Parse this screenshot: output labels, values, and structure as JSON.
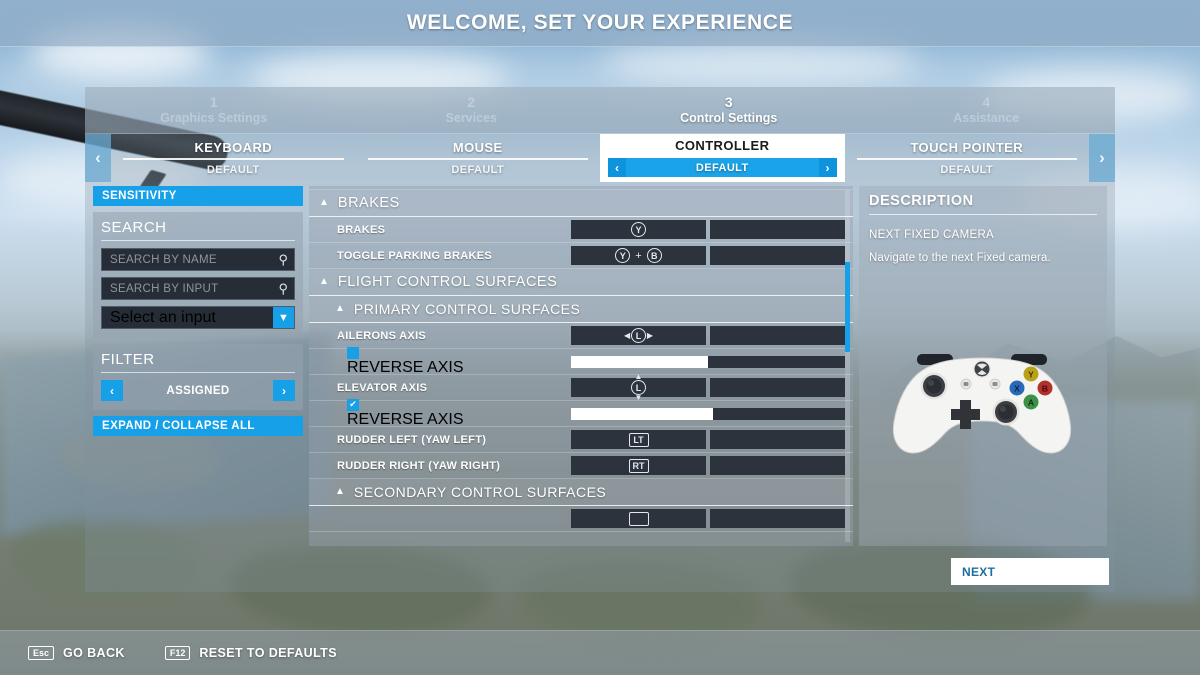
{
  "header": {
    "title": "WELCOME, SET YOUR EXPERIENCE"
  },
  "steps": [
    {
      "num": "1",
      "label": "Graphics Settings",
      "active": false
    },
    {
      "num": "2",
      "label": "Services",
      "active": false
    },
    {
      "num": "3",
      "label": "Control Settings",
      "active": true
    },
    {
      "num": "4",
      "label": "Assistance",
      "active": false
    }
  ],
  "device_tabs": {
    "prev_icon": "chevron-left-icon",
    "next_icon": "chevron-right-icon",
    "items": [
      {
        "name": "KEYBOARD",
        "preset": "DEFAULT",
        "selected": false
      },
      {
        "name": "MOUSE",
        "preset": "DEFAULT",
        "selected": false
      },
      {
        "name": "CONTROLLER",
        "preset": "DEFAULT",
        "selected": true
      },
      {
        "name": "TOUCH POINTER",
        "preset": "DEFAULT",
        "selected": false
      }
    ]
  },
  "sidebar": {
    "sensitivity_label": "SENSITIVITY",
    "search_title": "SEARCH",
    "search_by_name_placeholder": "SEARCH BY NAME",
    "search_by_name_value": "",
    "search_by_input_placeholder": "SEARCH BY INPUT",
    "search_by_input_value": "",
    "select_input_value": "Select an input",
    "filter_title": "FILTER",
    "filter_value": "ASSIGNED",
    "filter_prev": "‹",
    "filter_next": "›",
    "expand_collapse_label": "EXPAND / COLLAPSE ALL"
  },
  "list": {
    "groups": [
      {
        "type": "group",
        "level": 1,
        "label": "BRAKES",
        "collapsed": false,
        "rows": [
          {
            "type": "binding",
            "label": "BRAKES",
            "bind_kind": "buttons",
            "buttons": [
              "Y"
            ]
          },
          {
            "type": "binding",
            "label": "TOGGLE PARKING BRAKES",
            "bind_kind": "combo",
            "buttons": [
              "Y",
              "B"
            ],
            "separator": "+"
          }
        ]
      },
      {
        "type": "group",
        "level": 1,
        "label": "FLIGHT CONTROL SURFACES",
        "collapsed": false,
        "rows": []
      },
      {
        "type": "group",
        "level": 2,
        "label": "PRIMARY CONTROL SURFACES",
        "collapsed": false,
        "rows": [
          {
            "type": "binding",
            "label": "AILERONS AXIS",
            "bind_kind": "stick",
            "stick": "L",
            "axis": "horizontal"
          },
          {
            "type": "checkbox-slider",
            "label": "REVERSE AXIS",
            "checked": false,
            "slider_pct": 50
          },
          {
            "type": "binding",
            "label": "ELEVATOR AXIS",
            "bind_kind": "stick",
            "stick": "L",
            "axis": "vertical"
          },
          {
            "type": "checkbox-slider",
            "label": "REVERSE AXIS",
            "checked": true,
            "slider_pct": 52
          },
          {
            "type": "binding",
            "label": "RUDDER LEFT (YAW LEFT)",
            "bind_kind": "trigger",
            "trigger": "LT"
          },
          {
            "type": "binding",
            "label": "RUDDER RIGHT (YAW RIGHT)",
            "bind_kind": "trigger",
            "trigger": "RT"
          }
        ]
      },
      {
        "type": "group",
        "level": 2,
        "label": "SECONDARY CONTROL SURFACES",
        "collapsed": false,
        "rows": []
      }
    ],
    "scrollbar": {
      "thumb_top_pct": 20,
      "thumb_height_pct": 25
    }
  },
  "description": {
    "title": "DESCRIPTION",
    "subject": "NEXT FIXED CAMERA",
    "text": "Navigate to the next Fixed camera.",
    "device_image": "xbox-controller-image"
  },
  "next_button": {
    "label": "NEXT"
  },
  "footer": {
    "items": [
      {
        "key": "Esc",
        "label": "GO BACK"
      },
      {
        "key": "F12",
        "label": "RESET TO DEFAULTS"
      }
    ]
  },
  "colors": {
    "accent_blue": "#15a0e8",
    "panel_gray": "#94a0ac",
    "field_dark": "#272d36",
    "white": "#ffffff"
  }
}
